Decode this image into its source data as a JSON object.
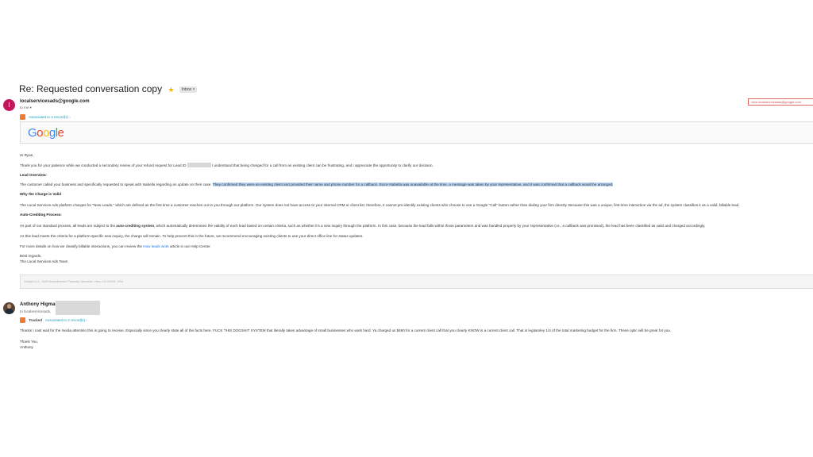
{
  "email": {
    "subject": "Re: Requested conversation copy",
    "label": "Inbox ×",
    "sender": "localservicesads@google.com",
    "to": "to me ▾",
    "avatar_letter": "I",
    "ext_button": "view.localservicesads@google.com",
    "associated": "Associated to 4 record(s) ›",
    "logo_letters": [
      {
        "ch": "G",
        "color": "#4285f4"
      },
      {
        "ch": "o",
        "color": "#ea4335"
      },
      {
        "ch": "o",
        "color": "#fbbc05"
      },
      {
        "ch": "g",
        "color": "#4285f4"
      },
      {
        "ch": "l",
        "color": "#34a853"
      },
      {
        "ch": "e",
        "color": "#ea4335"
      }
    ],
    "greeting": "Hi Ryan,",
    "p1_a": "Thank you for your patience while we conducted a secondary review of your refund request for Lead ID",
    "p1_b": "I understand that being charged for a call from an existing client can be frustrating, and I appreciate the opportunity to clarify our decision.",
    "h_overview": "Lead Overview:",
    "p2_a": "The customer called your business and specifically requested to speak with Isabella regarding an update on their case.",
    "p2_b": "They confirmed they were an existing client and provided their name and phone number for a callback. Since Isabella was unavailable at the time, a message was taken by your representative, and it was confirmed that a callback would be arranged.",
    "h_why": "Why the Charge is Valid",
    "p3": "The Local Services Ads platform charges for \"New Leads,\" which are defined as the first time a customer reaches out to you through our platform. Our system does not have access to your internal CRM or client list; therefore, it cannot pre-identify existing clients who choose to use a Google \"Call\" button rather than dialing your firm directly. Because this was a unique, first-time interaction via the ad, the system classifies it as a valid, billable lead.",
    "h_auto": "Auto-Crediting Process:",
    "p4_a": "As part of our standard process, all leads are subject to the",
    "p4_bold": "auto-crediting system",
    "p4_b": ", which automatically determines the validity of each lead based on certain criteria, such as whether it's a new inquiry through the platform. In this case, because the lead falls within those parameters and was handled properly by your representative (i.e., a callback was promised), the lead has been classified as valid and charged accordingly.",
    "p5": "As this lead meets the criteria for a platform-specific new inquiry, the charge will remain. To help prevent this in the future, we recommend encouraging existing clients to use your direct office line for status updates.",
    "p6_a": "For more details on how we classify billable interactions, you can review the",
    "p6_link": "How leads work",
    "p6_b": "article in our Help Center.",
    "sign1": "Best regards,",
    "sign2": "The Local Services Ads Team",
    "footer": "Google LLC, 1600 Amphitheatre Parkway, Mountain View, CA 94043, USA"
  },
  "reply": {
    "name": "Anthony Higman",
    "to": "to localservicesads,",
    "tracked": "Tracked",
    "associated": "Associated to 2 record(s) ›",
    "body": "Thanks I cant wait for the media attention this is going to receive. Especially since you clearly state all of the facts here. FUCK THIS DOGSHIT SYSTEM that literally takes advantage of small businesses who work hard. Ya charged us $480 for a current client call that you clearly KNOW is a current client call. That is legitamley 1/4 of the total marketing budget for the firm. These optic will be great for you.",
    "thanks": "Thank You,",
    "sig": "Anthony"
  },
  "colors": {
    "accent_orange": "#ef7a3a",
    "link_blue": "#1a73e8",
    "highlight": "#bcd7f5",
    "avatar_pink": "#c2185b"
  }
}
